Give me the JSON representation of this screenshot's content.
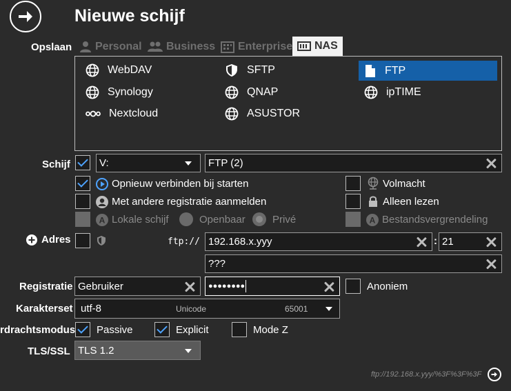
{
  "title": "Nieuwe schijf",
  "labels": {
    "opslaan": "Opslaan",
    "schijf": "Schijf",
    "adres": "Adres",
    "registratie": "Registratie",
    "karakterset": "Karakterset",
    "overdrachtsmodus": "rdrachtsmodus",
    "tls": "TLS/SSL"
  },
  "tabs": [
    {
      "label": "Personal"
    },
    {
      "label": "Business"
    },
    {
      "label": "Enterprise"
    },
    {
      "label": "NAS"
    }
  ],
  "protocols": [
    {
      "label": "WebDAV"
    },
    {
      "label": "SFTP"
    },
    {
      "label": "FTP"
    },
    {
      "label": "Synology"
    },
    {
      "label": "QNAP"
    },
    {
      "label": "ipTIME"
    },
    {
      "label": "Nextcloud"
    },
    {
      "label": "ASUSTOR"
    }
  ],
  "drive": {
    "letter": "V:",
    "name": "FTP (2)"
  },
  "options": {
    "reconnect": "Opnieuw verbinden bij starten",
    "proxy": "Volmacht",
    "other_login": "Met andere registratie aanmelden",
    "readonly": "Alleen lezen",
    "local": "Lokale schijf",
    "public": "Openbaar",
    "private": "Privé",
    "filelock": "Bestandsvergrendeling"
  },
  "address": {
    "scheme": "ftp://",
    "host": "192.168.x.yyy",
    "colon": ":",
    "port": "21",
    "path": "???"
  },
  "login": {
    "user": "Gebruiker",
    "password": "●●●●●●●●",
    "anonymous": "Anoniem"
  },
  "charset": {
    "value": "utf-8",
    "name": "Unicode",
    "code": "65001"
  },
  "transfer": {
    "passive": "Passive",
    "explicit": "Explicit",
    "modez": "Mode Z"
  },
  "tls": {
    "value": "TLS 1.2"
  },
  "footer": {
    "url": "ftp://192.168.x.yyy/%3F%3F%3F"
  },
  "colors": {
    "accent": "#1560a8",
    "check": "#4ea3ff",
    "background": "#2b2b2b"
  }
}
